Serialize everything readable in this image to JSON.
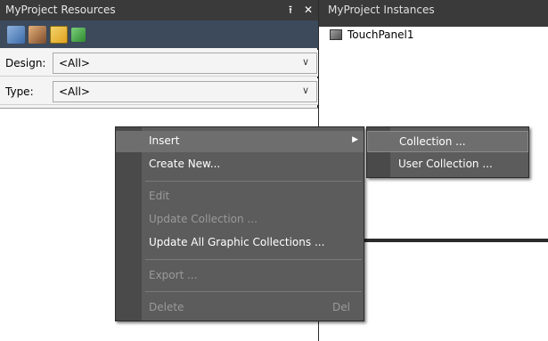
{
  "resources_panel": {
    "title": "MyProject Resources",
    "pin_glyph": "⭱",
    "close_glyph": "✕",
    "toolbar_icons": [
      "resources-icon",
      "graphics-icon",
      "collection-folder-icon",
      "list-icon"
    ],
    "design_label": "Design:",
    "design_value": "<All>",
    "type_label": "Type:",
    "type_value": "<All>"
  },
  "instances_panel": {
    "title": "MyProject Instances",
    "items": [
      {
        "label": "TouchPanel1",
        "icon": "touch-panel-icon"
      }
    ]
  },
  "context_menu": {
    "items": [
      {
        "label": "Insert",
        "enabled": true,
        "highlighted": true,
        "submenu": true
      },
      {
        "label": "Create New...",
        "enabled": true
      },
      {
        "label": "Edit",
        "enabled": false
      },
      {
        "label": "Update Collection ...",
        "enabled": false
      },
      {
        "label": "Update All Graphic Collections ...",
        "enabled": true
      },
      {
        "label": "Export ...",
        "enabled": false
      },
      {
        "label": "Delete",
        "enabled": false,
        "shortcut": "Del"
      }
    ]
  },
  "submenu": {
    "items": [
      {
        "label": "Collection ...",
        "highlighted": true
      },
      {
        "label": "User Collection ..."
      }
    ]
  },
  "colors": {
    "menu_bg": "#5c5c5c",
    "menu_highlight": "#6e6e6e",
    "title_bar": "#3a3a3a",
    "toolbar": "#3c4a5c"
  }
}
